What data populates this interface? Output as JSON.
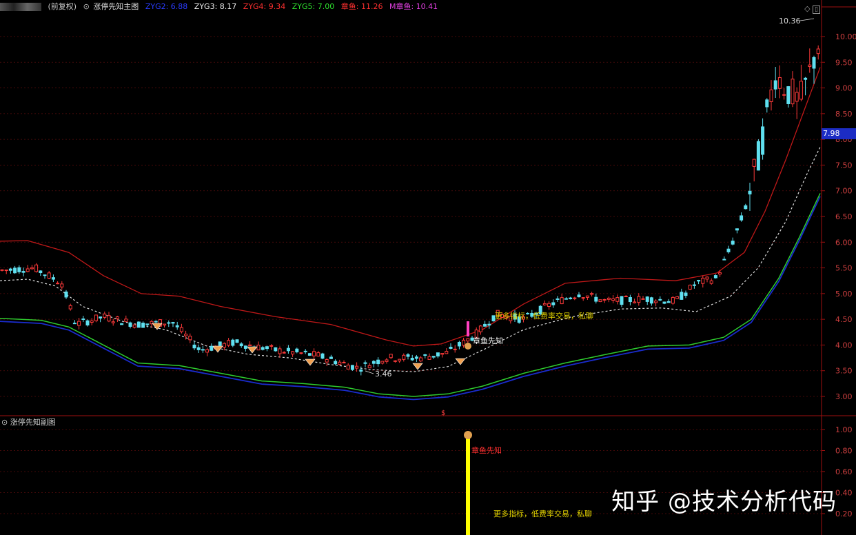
{
  "header": {
    "mode_label": "(前复权)",
    "indicator_title": "涨停先知主图",
    "zyg2": "ZYG2: 6.88",
    "zyg3": "ZYG3: 8.17",
    "zyg4": "ZYG4: 9.34",
    "zyg5": "ZYG5: 7.00",
    "zhangyu": "章鱼: 11.26",
    "mzhangyu": "M章鱼: 10.41"
  },
  "main_axis": [
    "10.00",
    "9.50",
    "9.00",
    "8.50",
    "8.00",
    "7.50",
    "7.00",
    "6.50",
    "6.00",
    "5.50",
    "5.00",
    "4.50",
    "4.00",
    "3.50",
    "3.00"
  ],
  "current_price": "7.98",
  "high_label": "10.36",
  "low_label": "3.46",
  "signal_label": "章鱼先知",
  "promo_text": "更多指标，低费率交易，私聊",
  "sub_title": "涨停先知副图",
  "sub_axis": [
    "1.00",
    "0.80",
    "0.60",
    "0.40",
    "0.20"
  ],
  "sub_signal_label": "章鱼先知",
  "sub_promo_text": "更多指标，低费率交易，私聊",
  "watermark": "知乎 @技术分析代码",
  "colors": {
    "up": "#ff3a3a",
    "down": "#5fe0f0",
    "upper_band": "#c01818",
    "mid_line": "#dddddd",
    "lower_green": "#2ecc2e",
    "lower_blue": "#1a2ccf",
    "grid": "#8a1010",
    "axis_text": "#d04040",
    "signal_bar": "#ffff00",
    "promo": "#e0d000"
  },
  "chart_data": {
    "type": "candlestick",
    "ylim": [
      2.8,
      10.5
    ],
    "candles": [],
    "note_visible_range": "3.46 - 10.36"
  }
}
